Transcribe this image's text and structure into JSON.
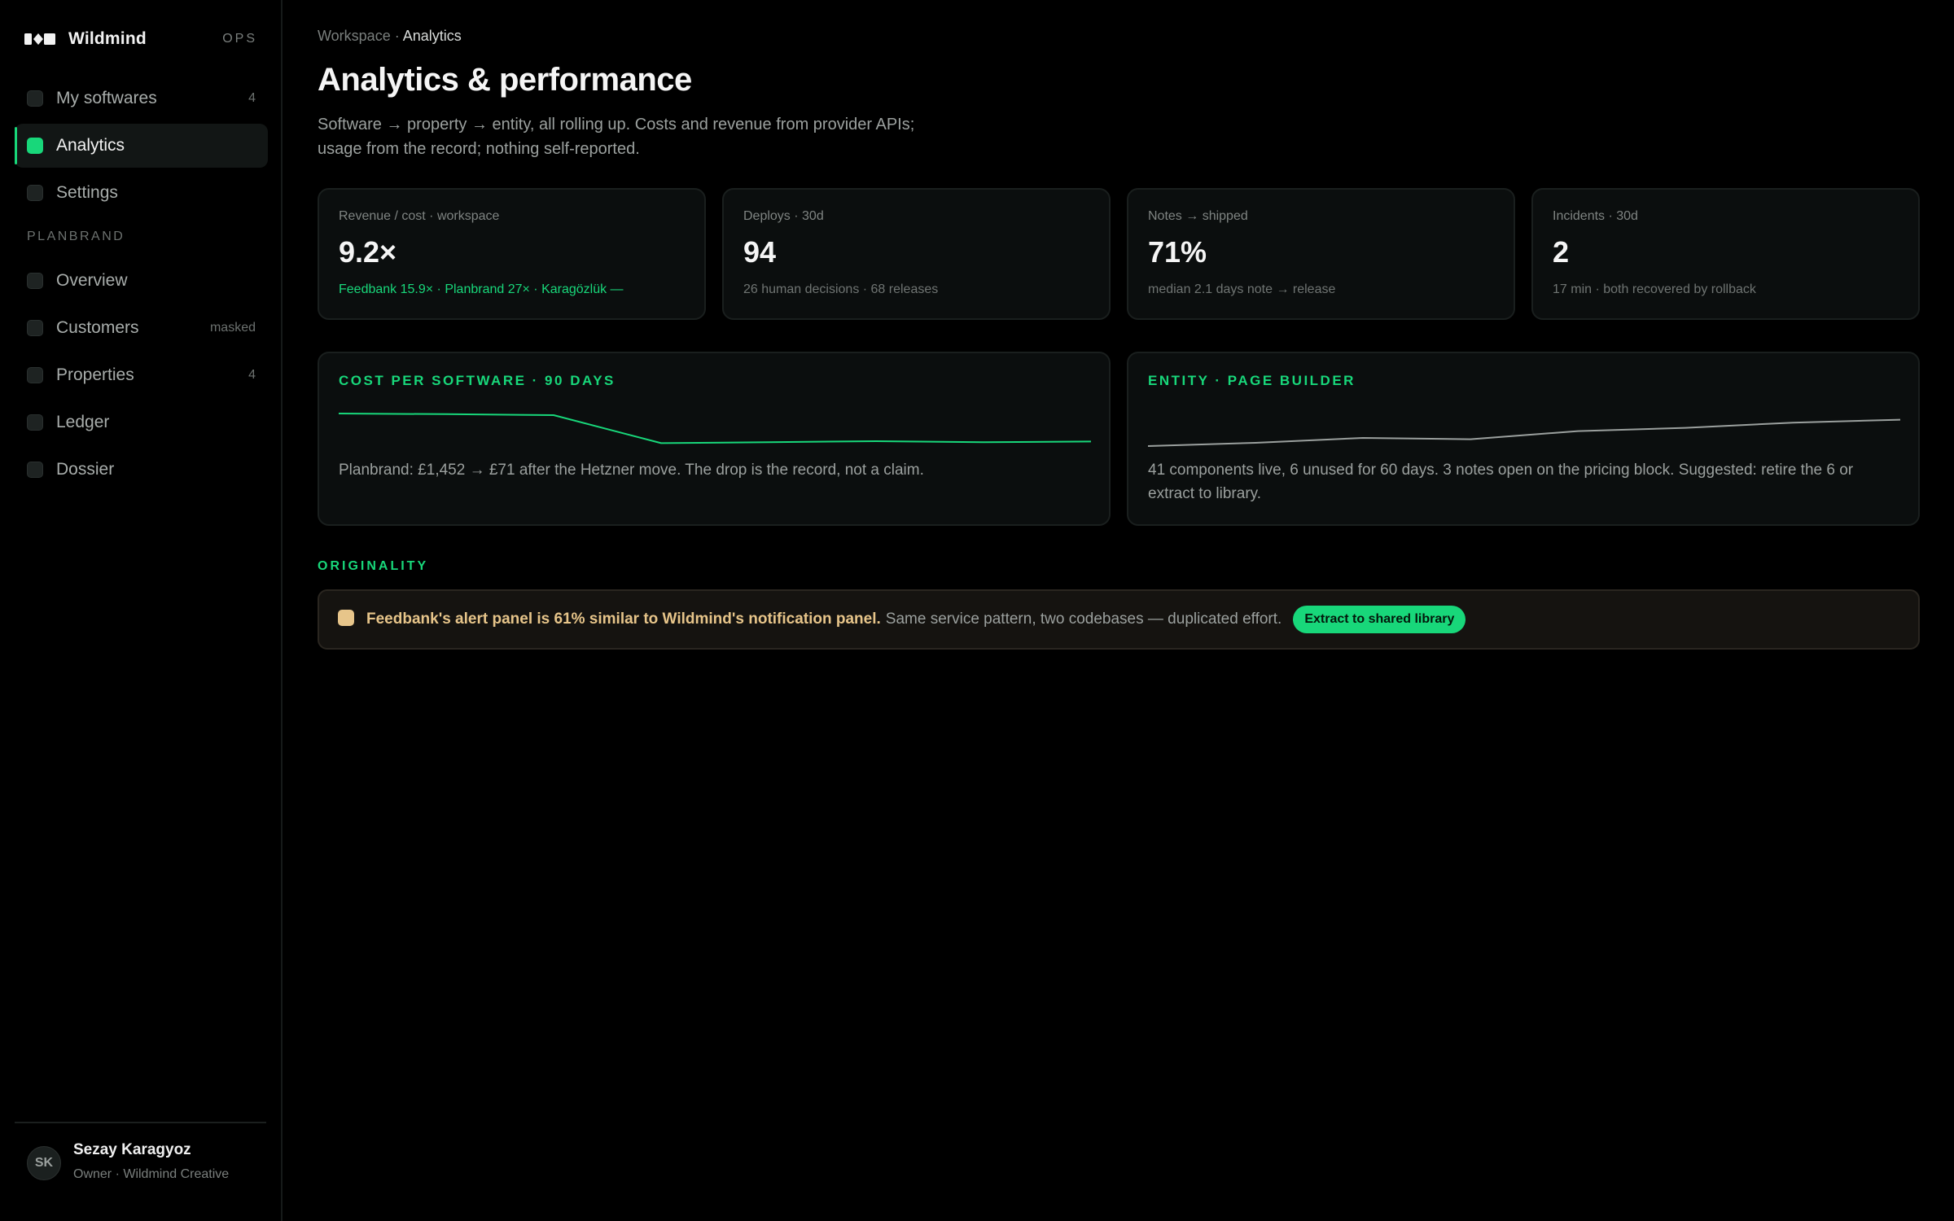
{
  "app": {
    "name": "Wildmind",
    "tag": "OPS"
  },
  "sidebar": {
    "primary": [
      {
        "label": "My softwares",
        "count": "4"
      },
      {
        "label": "Analytics",
        "count": ""
      },
      {
        "label": "Settings",
        "count": ""
      }
    ],
    "section_title": "PLANBRAND",
    "secondary": [
      {
        "label": "Overview",
        "count": ""
      },
      {
        "label": "Customers",
        "count": "masked"
      },
      {
        "label": "Properties",
        "count": "4"
      },
      {
        "label": "Ledger",
        "count": ""
      },
      {
        "label": "Dossier",
        "count": ""
      }
    ],
    "active": "Analytics"
  },
  "user": {
    "initials": "SK",
    "name": "Sezay Karagyoz",
    "role": "Owner · Wildmind Creative"
  },
  "breadcrumb": {
    "parent": "Workspace",
    "separator": " · ",
    "current": "Analytics"
  },
  "page": {
    "title": "Analytics & performance",
    "description": "Software → property → entity, all rolling up. Costs and revenue from provider APIs; usage from the record; nothing self-reported."
  },
  "stats": [
    {
      "label": "Revenue / cost · workspace",
      "value": "9.2×",
      "note": "Feedbank 15.9× · Planbrand 27× · Karagözlük —"
    },
    {
      "label": "Deploys · 30d",
      "value": "94",
      "note": "26 human decisions · 68 releases"
    },
    {
      "label": "Notes → shipped",
      "value": "71%",
      "note": "median 2.1 days note → release"
    },
    {
      "label": "Incidents · 30d",
      "value": "2",
      "note": "17 min · both recovered by rollback"
    }
  ],
  "panels": [
    {
      "title": "COST PER SOFTWARE · 90 DAYS",
      "text": "Planbrand: £1,452 → £71 after the Hetzner move. The drop is the record, not a claim."
    },
    {
      "title": "ENTITY · PAGE BUILDER",
      "text": "41 components live, 6 unused for 60 days. 3 notes open on the pricing block. Suggested: retire the 6 or extract to library."
    }
  ],
  "chart_data": [
    {
      "type": "line",
      "title": "COST PER SOFTWARE · 90 DAYS",
      "color": "#18d77a",
      "values": [
        1.0,
        0.98,
        0.95,
        0.09,
        0.12,
        0.15,
        0.12,
        0.14
      ]
    },
    {
      "type": "line",
      "title": "ENTITY · PAGE BUILDER",
      "color": "#9ba09e",
      "values": [
        0.0,
        0.1,
        0.25,
        0.21,
        0.46,
        0.56,
        0.72,
        0.81
      ]
    }
  ],
  "originality": {
    "section_title": "ORIGINALITY",
    "alert_strong": "Feedbank's alert panel is 61% similar to Wildmind's notification panel.",
    "alert_text": "Same service pattern, two codebases — duplicated effort.",
    "action_label": "Extract to shared library"
  },
  "colors": {
    "accent": "#18d77a",
    "warning": "#e7c58a",
    "background": "#000000",
    "card": "#0b0e0e"
  }
}
